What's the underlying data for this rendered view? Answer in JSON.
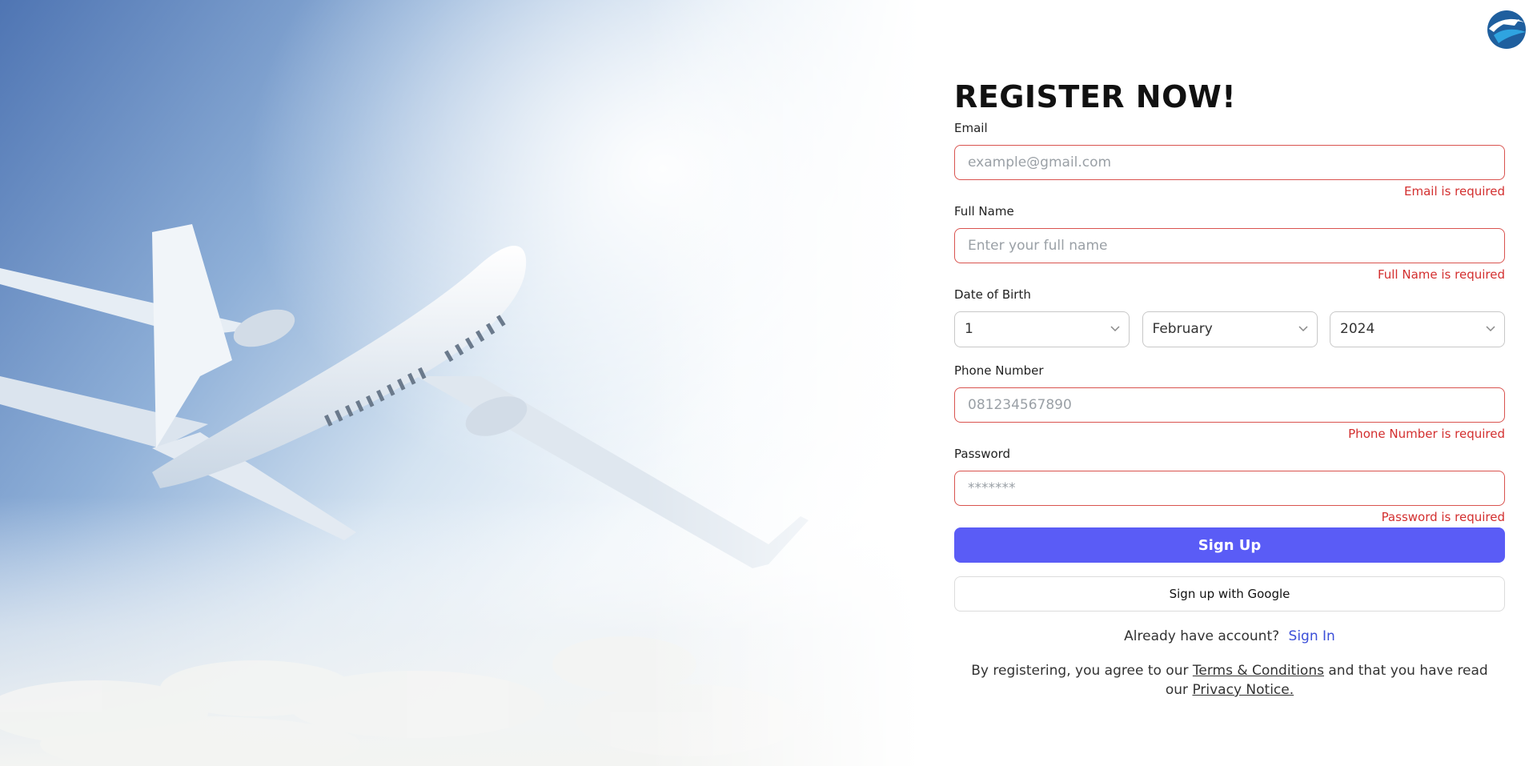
{
  "form": {
    "title": "REGISTER NOW!",
    "email": {
      "label": "Email",
      "placeholder": "example@gmail.com",
      "value": "",
      "error": "Email is required"
    },
    "full_name": {
      "label": "Full Name",
      "placeholder": "Enter your full name",
      "value": "",
      "error": "Full Name is required"
    },
    "dob": {
      "label": "Date of Birth",
      "day": "1",
      "month": "February",
      "year": "2024"
    },
    "phone": {
      "label": "Phone Number",
      "placeholder": "081234567890",
      "value": "",
      "error": "Phone Number is required"
    },
    "password": {
      "label": "Password",
      "placeholder": "*******",
      "value": "",
      "error": "Password is required"
    },
    "signup_label": "Sign Up",
    "google_label": "Sign up with Google",
    "signin_prompt": "Already have account?",
    "signin_link": "Sign In",
    "legal": {
      "prefix": "By registering, you agree to our",
      "terms": "Terms & Conditions",
      "middle": "and that you have read our",
      "privacy": "Privacy Notice."
    }
  },
  "icons": {
    "logo": "airline-logo-icon",
    "chevron": "chevron-down-icon"
  },
  "colors": {
    "accent": "#5a5cf6",
    "error": "#d32f2f",
    "error_border": "#d9534f",
    "link": "#3b4fd8"
  }
}
